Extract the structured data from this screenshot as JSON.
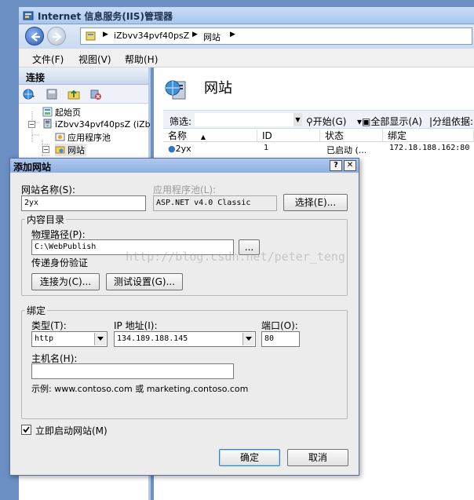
{
  "window": {
    "title": "Internet 信息服务(IIS)管理器"
  },
  "address": {
    "crumbs": [
      "iZbvv34pvf40psZ",
      "网站"
    ]
  },
  "menu": {
    "items": [
      "文件(F)",
      "视图(V)",
      "帮助(H)"
    ]
  },
  "connections": {
    "header": "连接",
    "tree": [
      {
        "label": "起始页"
      },
      {
        "label": "iZbvv34pvf40psZ (iZb"
      },
      {
        "label": "应用程序池"
      },
      {
        "label": "网站"
      }
    ]
  },
  "sites": {
    "title": "网站",
    "filter_label": "筛选:",
    "start_label": "开始(G)",
    "show_all_label": "全部显示(A)",
    "group_label": "分组依据:",
    "columns": [
      "名称",
      "ID",
      "状态",
      "绑定"
    ],
    "rows": [
      {
        "name": "2yx",
        "id": "1",
        "status": "已启动 (...",
        "binding": "172.18.188.162:80"
      }
    ]
  },
  "dialog": {
    "title": "添加网站",
    "help_btn": "?",
    "close_btn": "✕",
    "site_name_label": "网站名称(S):",
    "site_name_value": "2yx",
    "app_pool_label": "应用程序池(L):",
    "app_pool_value": "ASP.NET v4.0 Classic",
    "select_btn": "选择(E)...",
    "content_dir": {
      "legend": "内容目录",
      "physical_path_label": "物理路径(P):",
      "physical_path_value": "C:\\WebPublish",
      "browse_btn": "...",
      "pass_through_label": "传递身份验证",
      "connect_as_btn": "连接为(C)...",
      "test_settings_btn": "测试设置(G)..."
    },
    "binding": {
      "legend": "绑定",
      "type_label": "类型(T):",
      "type_value": "http",
      "ip_label": "IP 地址(I):",
      "ip_value": "134.189.188.145",
      "port_label": "端口(O):",
      "port_value": "80",
      "host_label": "主机名(H):",
      "host_value": "",
      "example_text": "示例: www.contoso.com 或 marketing.contoso.com"
    },
    "start_now_label": "立即启动网站(M)",
    "start_now_checked": true,
    "ok_btn": "确定",
    "cancel_btn": "取消"
  },
  "watermark": "http://blog.csdn.net/peter_teng"
}
